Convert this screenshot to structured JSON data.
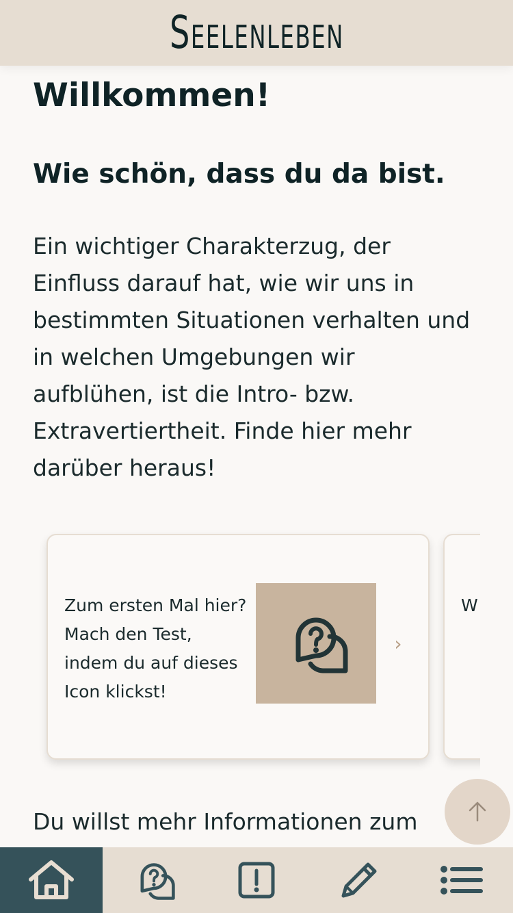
{
  "header": {
    "logo_text": "Seelenleben"
  },
  "main": {
    "title": "Willkommen!",
    "subtitle": "Wie schön, dass du da bist.",
    "intro": "Ein wichtiger Charakterzug, der Einfluss darauf hat, wie wir uns in bestimmten Situationen verhalten und in welchen Umgebungen wir aufblühen, ist die Intro- bzw. Extravertiertheit. Finde hier mehr darüber heraus!",
    "more_text": "Du willst mehr Informationen zum"
  },
  "carousel": {
    "cards": [
      {
        "text": "Zum ersten Mal hier? Mach den Test, indem du auf dieses Icon klickst!",
        "icon": "question-bubbles-icon"
      },
      {
        "text": "W te di Te",
        "icon": ""
      }
    ],
    "chevron": "›"
  },
  "nav": {
    "items": [
      {
        "name": "home",
        "icon": "home-icon",
        "active": true
      },
      {
        "name": "test",
        "icon": "question-bubbles-icon",
        "active": false
      },
      {
        "name": "info",
        "icon": "exclamation-icon",
        "active": false
      },
      {
        "name": "journal",
        "icon": "pencil-icon",
        "active": false
      },
      {
        "name": "menu",
        "icon": "list-icon",
        "active": false
      }
    ]
  },
  "colors": {
    "header_bg": "#e6ddd2",
    "page_bg": "#faf8f6",
    "icon_tile": "#c8b49e",
    "nav_active": "#35525a",
    "text_dark": "#0f2326"
  }
}
